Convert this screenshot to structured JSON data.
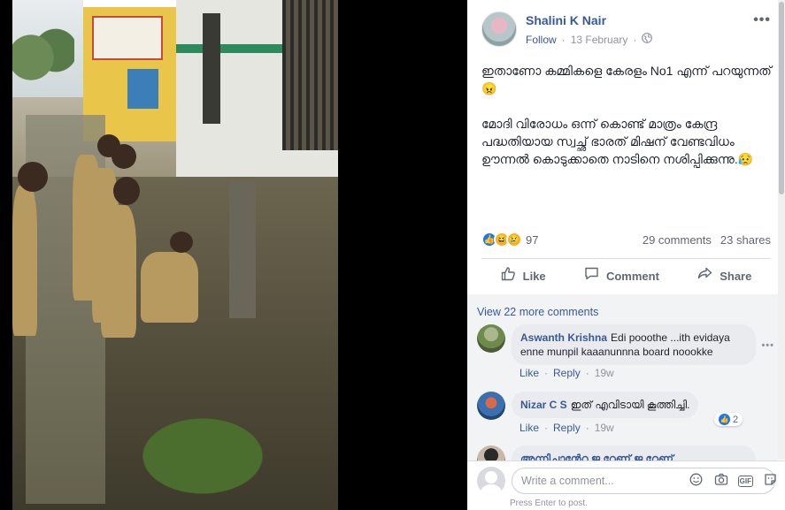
{
  "post": {
    "author": "Shalini K Nair",
    "follow": "Follow",
    "separator": "·",
    "date": "13 February",
    "privacy_icon": "globe-icon",
    "text": "ഇതാണോ കമ്മികളെ കേരളം No1 എന്ന് പറയുന്നത്😠\n\nമോദി വിരോധം ഒന്ന് കൊണ്ട് മാത്രം കേന്ദ്ര പദ്ധതിയായ സ്വച്ഛ് ഭാരത് മിഷന് വേണ്ടവിധം ഊന്നൽ കൊടുക്കാതെ നാടിനെ നശിപ്പിക്കുന്നു.😥",
    "reaction_count": "97",
    "comments_count": "29 comments",
    "shares_count": "23 shares"
  },
  "actions": {
    "like": "Like",
    "comment": "Comment",
    "share": "Share"
  },
  "comments": {
    "view_more": "View 22 more comments",
    "items": [
      {
        "name": "Aswanth Krishna",
        "text": "Edi pooothe ...ith evidaya enne munpil kaaanunnna board noookke",
        "like": "Like",
        "reply": "Reply",
        "time": "19w"
      },
      {
        "name": "Nizar C S",
        "text": "ഇത് എവിടായി കൂത്തിച്ചി.",
        "like": "Like",
        "reply": "Reply",
        "time": "19w",
        "reactions": "2"
      },
      {
        "name": "",
        "text": "അന്നിച്ചാന്റേറ ജ റേണ് ജ റേണ്",
        "like": "",
        "reply": "",
        "time": ""
      }
    ]
  },
  "composer": {
    "placeholder": "Write a comment...",
    "gif_label": "GIF",
    "hint": "Press Enter to post."
  },
  "colors": {
    "link": "#385898",
    "like_blue": "#1877f2",
    "text": "#1d2129",
    "muted": "#90949c"
  }
}
